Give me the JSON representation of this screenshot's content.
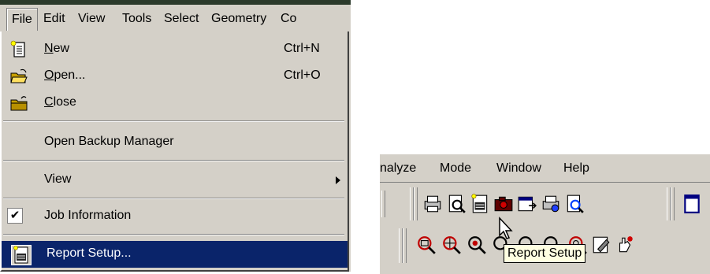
{
  "menubar": {
    "items": [
      "File",
      "Edit",
      "View",
      "Tools",
      "Select",
      "Geometry",
      "Co"
    ]
  },
  "file_menu": {
    "new": {
      "label": "New",
      "accel": "N",
      "shortcut": "Ctrl+N"
    },
    "open": {
      "label": "Open...",
      "accel": "O",
      "shortcut": "Ctrl+O"
    },
    "close": {
      "label": "Close",
      "accel": "C"
    },
    "backup": {
      "label": "Open Backup Manager"
    },
    "view": {
      "label": "View"
    },
    "job": {
      "label": "Job Information",
      "checked": true
    },
    "report": {
      "label": "Report Setup..."
    }
  },
  "right_menubar": {
    "items": [
      "nalyze",
      "Mode",
      "Window",
      "Help"
    ]
  },
  "tooltip": {
    "text": "Report Setup"
  },
  "icons": {
    "new": "new-document-icon",
    "open": "open-folder-icon",
    "close": "close-folder-icon",
    "report": "report-setup-icon",
    "print": "print-icon",
    "print_preview": "print-preview-icon",
    "camera": "camera-icon",
    "export": "export-icon",
    "printer_settings": "printer-settings-icon",
    "preview": "preview-icon",
    "window": "window-icon",
    "zoom_window": "zoom-window-icon",
    "zoom_center": "zoom-center-icon",
    "zoom_in": "zoom-in-icon",
    "zoom_out": "zoom-out-icon",
    "zoom_all": "zoom-all-icon",
    "zoom_extents": "zoom-extents-icon",
    "edit": "edit-icon",
    "pan": "pan-icon"
  },
  "colors": {
    "highlight": "#0a246a",
    "menu_bg": "#d4d0c8",
    "tooltip_bg": "#ffffe1"
  }
}
